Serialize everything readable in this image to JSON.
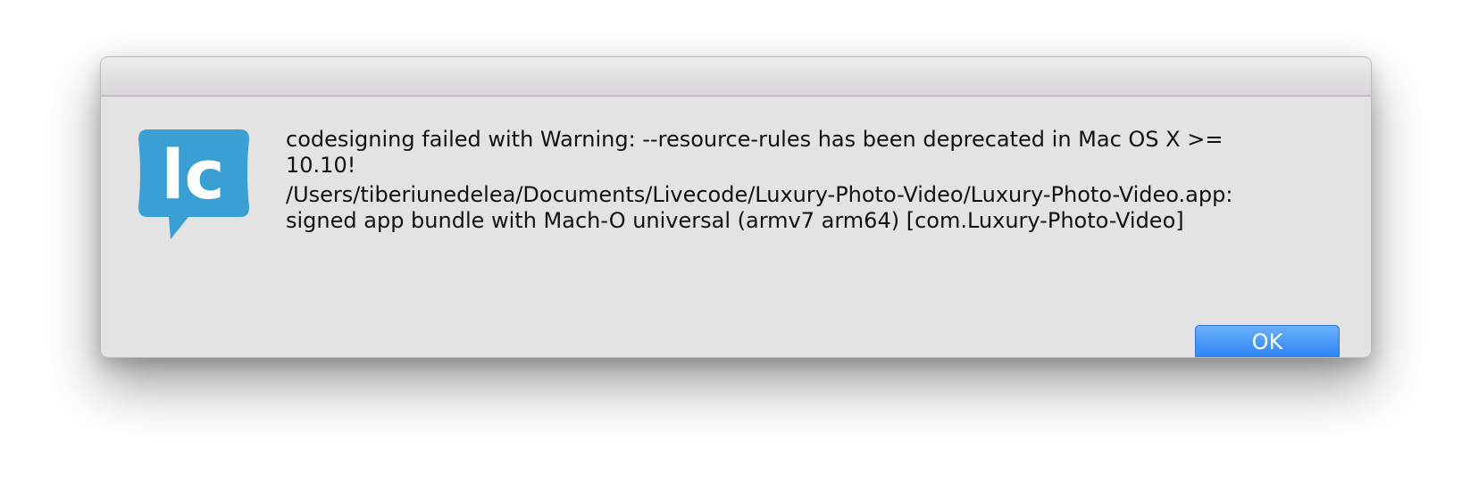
{
  "dialog": {
    "message_lines": [
      "codesigning failed with Warning: --resource-rules has been deprecated in Mac OS X >=",
      "10.10!",
      "/Users/tiberiunedelea/Documents/Livecode/Luxury-Photo-Video/Luxury-Photo-Video.app:",
      "signed app bundle with Mach-O universal (armv7 arm64) [com.Luxury-Photo-Video]"
    ],
    "ok_label": "OK",
    "app_icon": {
      "name": "livecode-logo-icon",
      "text": "lc",
      "color": "#3a9fd2"
    }
  },
  "colors": {
    "dialog_background": "#e3e3e3",
    "button_blue": "#2a82f4"
  }
}
